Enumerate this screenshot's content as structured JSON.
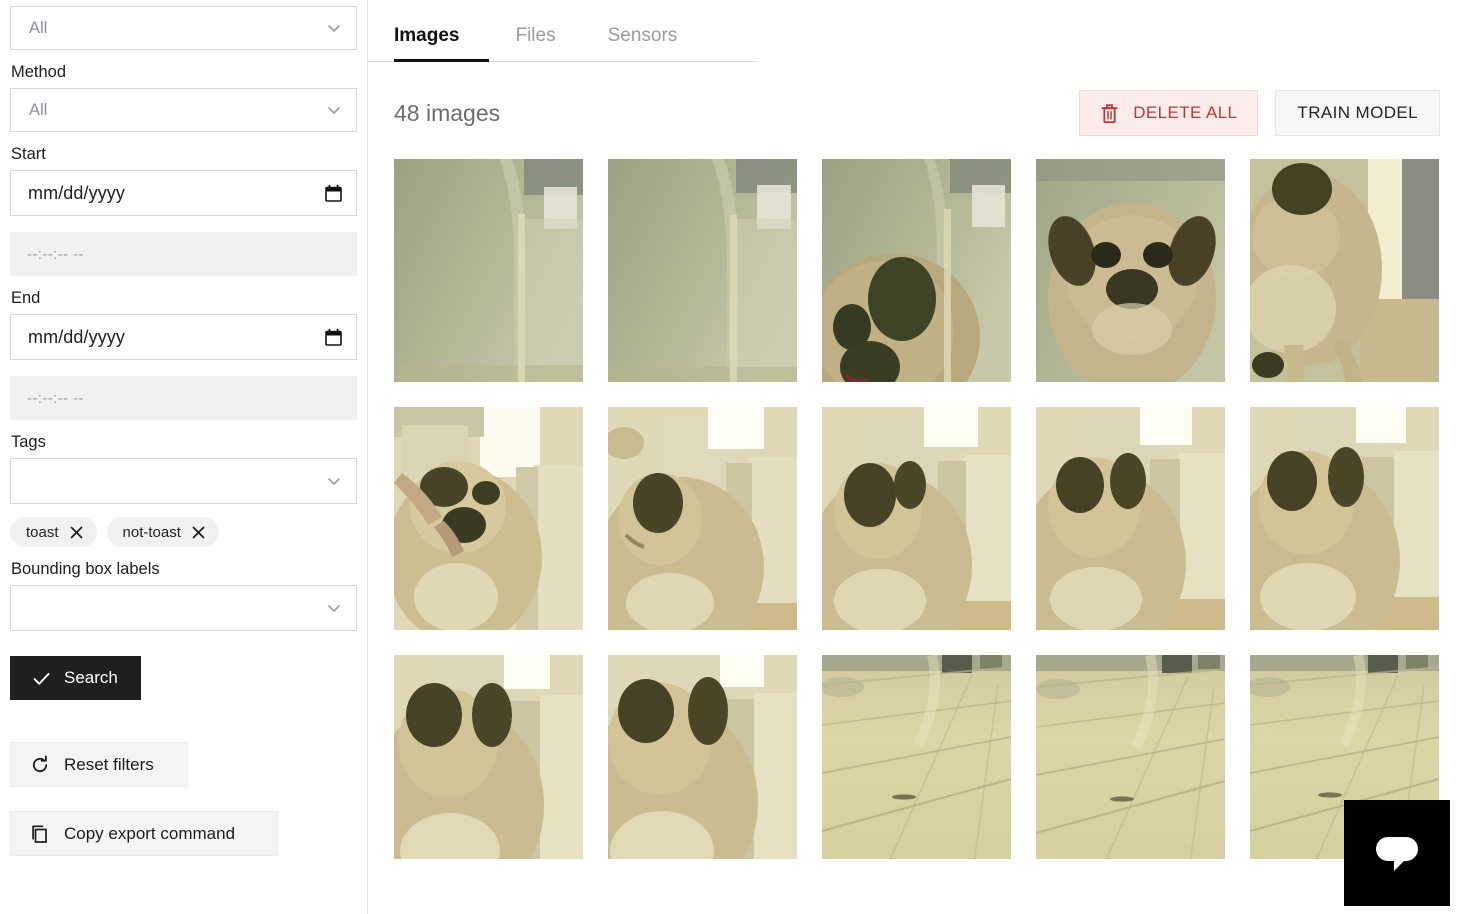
{
  "sidebar": {
    "filters": [
      {
        "label": "",
        "value": "All",
        "placeholder": "All"
      },
      {
        "label": "Method",
        "value": "All",
        "placeholder": "All"
      }
    ],
    "label_method": "Method",
    "label_start": "Start",
    "label_end": "End",
    "label_tags": "Tags",
    "label_bbox": "Bounding box labels",
    "select_all_value": "All",
    "method_value": "All",
    "start_date_placeholder": "mm/dd/yyyy",
    "start_time_placeholder": "--:--:-- --",
    "end_date_placeholder": "mm/dd/yyyy",
    "end_time_placeholder": "--:--:-- --",
    "tags_value": "",
    "bbox_value": "",
    "tag_chips": [
      {
        "label": "toast"
      },
      {
        "label": "not-toast"
      }
    ],
    "search_label": "Search",
    "reset_label": "Reset filters",
    "copy_label": "Copy export command"
  },
  "main": {
    "tabs": [
      {
        "label": "Images",
        "active": true
      },
      {
        "label": "Files",
        "active": false
      },
      {
        "label": "Sensors",
        "active": false
      }
    ],
    "count_text": "48 images",
    "delete_all_label": "DELETE ALL",
    "train_model_label": "TRAIN MODEL",
    "images": [
      {
        "alt": "wall-closeup-1",
        "scene": "wall"
      },
      {
        "alt": "wall-closeup-2",
        "scene": "wall"
      },
      {
        "alt": "pug-head-tilt-left",
        "scene": "dog-left"
      },
      {
        "alt": "pug-face-front",
        "scene": "dog-face"
      },
      {
        "alt": "pug-body-standing",
        "scene": "dog-body"
      },
      {
        "alt": "pug-with-hand",
        "scene": "dog-hand"
      },
      {
        "alt": "pug-side-profile-1",
        "scene": "dog-side"
      },
      {
        "alt": "pug-side-profile-2",
        "scene": "dog-side"
      },
      {
        "alt": "pug-side-profile-3",
        "scene": "dog-side"
      },
      {
        "alt": "pug-side-profile-4",
        "scene": "dog-side"
      },
      {
        "alt": "pug-side-profile-5",
        "scene": "dog-side"
      },
      {
        "alt": "pug-side-profile-6",
        "scene": "dog-side"
      },
      {
        "alt": "kitchen-floor-1",
        "scene": "floor"
      },
      {
        "alt": "kitchen-floor-2",
        "scene": "floor"
      },
      {
        "alt": "kitchen-floor-3",
        "scene": "floor"
      }
    ]
  },
  "chat": {
    "launcher_icon": "chat-bubble-icon"
  },
  "colors": {
    "accent_dark": "#1f1f1f",
    "danger": "#b93a3a",
    "danger_bg": "#fbebeb",
    "muted_text": "#6d6d6d",
    "border": "#d9d9d9",
    "field_bg": "#f1f1f1"
  }
}
